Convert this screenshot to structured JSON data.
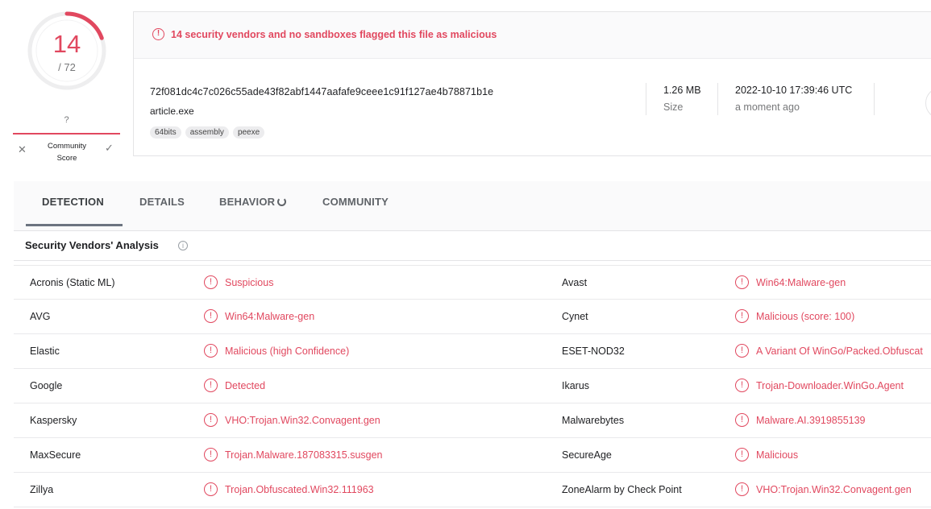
{
  "score": {
    "detected": "14",
    "total": "/ 72",
    "fraction": 0.194
  },
  "community": {
    "value": "?",
    "label": "Community Score",
    "dislike_icon": "close-icon",
    "like_icon": "check-icon"
  },
  "alert": {
    "text": "14 security vendors and no sandboxes flagged this file as malicious",
    "icon": "alert-circle-icon"
  },
  "file": {
    "hash": "72f081dc4c7c026c55ade43f82abf1447aafafe9ceee1c91f127ae4b78871b1e",
    "name": "article.exe",
    "tags": [
      "64bits",
      "assembly",
      "peexe"
    ],
    "size_value": "1.26 MB",
    "size_label": "Size",
    "date_value": "2022-10-10 17:39:46 UTC",
    "date_label": "a moment ago"
  },
  "tabs": [
    "DETECTION",
    "DETAILS",
    "BEHAVIOR",
    "COMMUNITY"
  ],
  "section": {
    "title": "Security Vendors' Analysis",
    "info_icon": "info-icon"
  },
  "vendors": [
    {
      "left_name": "Acronis (Static ML)",
      "left_result": "Suspicious",
      "right_name": "Avast",
      "right_result": "Win64:Malware-gen"
    },
    {
      "left_name": "AVG",
      "left_result": "Win64:Malware-gen",
      "right_name": "Cynet",
      "right_result": "Malicious (score: 100)"
    },
    {
      "left_name": "Elastic",
      "left_result": "Malicious (high Confidence)",
      "right_name": "ESET-NOD32",
      "right_result": "A Variant Of WinGo/Packed.Obfuscat"
    },
    {
      "left_name": "Google",
      "left_result": "Detected",
      "right_name": "Ikarus",
      "right_result": "Trojan-Downloader.WinGo.Agent"
    },
    {
      "left_name": "Kaspersky",
      "left_result": "VHO:Trojan.Win32.Convagent.gen",
      "right_name": "Malwarebytes",
      "right_result": "Malware.AI.3919855139"
    },
    {
      "left_name": "MaxSecure",
      "left_result": "Trojan.Malware.187083315.susgen",
      "right_name": "SecureAge",
      "right_result": "Malicious"
    },
    {
      "left_name": "Zillya",
      "left_result": "Trojan.Obfuscated.Win32.111963",
      "right_name": "ZoneAlarm by Check Point",
      "right_result": "VHO:Trojan.Win32.Convagent.gen"
    }
  ],
  "colors": {
    "accent": "#e1485f",
    "muted": "#77787a"
  }
}
